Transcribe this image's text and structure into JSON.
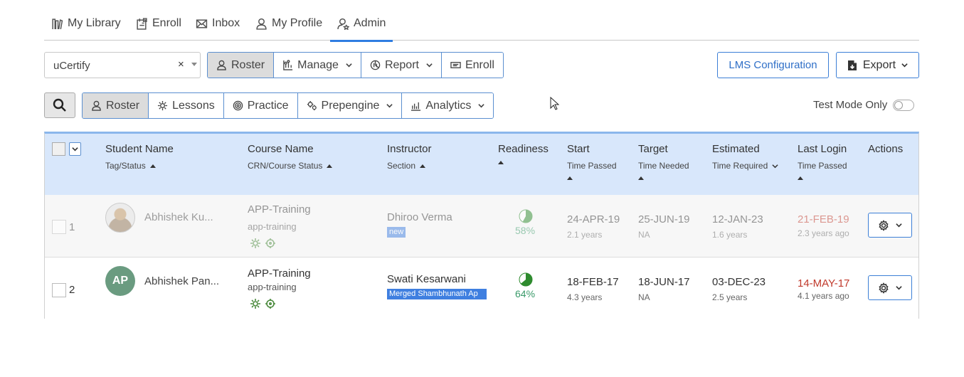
{
  "topnav": {
    "items": [
      {
        "label": "My Library",
        "icon": "library-icon"
      },
      {
        "label": "Enroll",
        "icon": "enroll-icon"
      },
      {
        "label": "Inbox",
        "icon": "inbox-icon"
      },
      {
        "label": "My Profile",
        "icon": "user-icon"
      },
      {
        "label": "Admin",
        "icon": "admin-icon",
        "active": true
      }
    ]
  },
  "toolbar": {
    "course_value": "uCertify",
    "clear_glyph": "×",
    "groups1": [
      {
        "label": "Roster",
        "active": true
      },
      {
        "label": "Manage"
      },
      {
        "label": "Report"
      },
      {
        "label": "Enroll"
      }
    ],
    "lms_label": "LMS Configuration",
    "export_label": "Export",
    "groups2": [
      {
        "label": "Roster",
        "active": true
      },
      {
        "label": "Lessons"
      },
      {
        "label": "Practice"
      },
      {
        "label": "Prepengine"
      },
      {
        "label": "Analytics"
      }
    ],
    "test_mode_label": "Test Mode Only",
    "test_mode_on": false
  },
  "table": {
    "headers": {
      "student": {
        "title": "Student Name",
        "sub": "Tag/Status"
      },
      "course": {
        "title": "Course Name",
        "sub": "CRN/Course Status"
      },
      "instructor": {
        "title": "Instructor",
        "sub": "Section"
      },
      "readiness": {
        "title": "Readiness"
      },
      "start": {
        "title": "Start",
        "sub": "Time Passed"
      },
      "target": {
        "title": "Target",
        "sub": "Time Needed"
      },
      "estimated": {
        "title": "Estimated",
        "sub": "Time Required"
      },
      "lastlogin": {
        "title": "Last Login",
        "sub": "Time Passed"
      },
      "actions": {
        "title": "Actions"
      }
    },
    "rows": [
      {
        "num": "1",
        "name": "Abhishek Ku...",
        "course": "APP-Training",
        "course_code": "app-training",
        "instructor": "Dhiroo Verma",
        "tag": "new",
        "readiness": "58%",
        "readiness_value": 0.58,
        "start": "24-APR-19",
        "start_sub": "2.1 years",
        "target": "25-JUN-19",
        "target_sub": "NA",
        "estimated": "12-JAN-23",
        "estimated_sub": "1.6 years",
        "lastlogin": "21-FEB-19",
        "lastlogin_sub": "2.3 years ago"
      },
      {
        "num": "2",
        "initials": "AP",
        "name": "Abhishek Pan...",
        "course": "APP-Training",
        "course_code": "app-training",
        "instructor": "Swati Kesarwani",
        "tag": "Merged Shambhunath Ap",
        "readiness": "64%",
        "readiness_value": 0.64,
        "start": "18-FEB-17",
        "start_sub": "4.3 years",
        "target": "18-JUN-17",
        "target_sub": "NA",
        "estimated": "03-DEC-23",
        "estimated_sub": "2.5 years",
        "lastlogin": "14-MAY-17",
        "lastlogin_sub": "4.1 years ago"
      }
    ]
  }
}
